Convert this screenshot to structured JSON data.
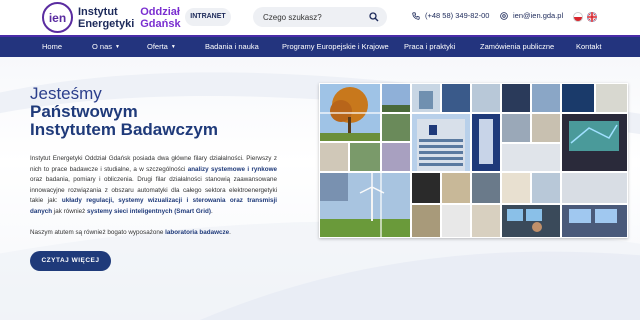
{
  "header": {
    "logo_mark": "ien",
    "logo_line1": "Instytut",
    "logo_line2": "Energetyki",
    "logo_sub1": "Oddział",
    "logo_sub2": "Gdańsk",
    "intranet_label": "INTRANET",
    "search_placeholder": "Czego szukasz?",
    "phone": "(+48 58) 349-82-00",
    "email": "ien@ien.gda.pl",
    "languages": [
      "pl",
      "en"
    ]
  },
  "nav": {
    "items": [
      {
        "label": "Home"
      },
      {
        "label": "O nas",
        "dropdown": true
      },
      {
        "label": "Oferta",
        "dropdown": true
      },
      {
        "label": "Badania i nauka"
      },
      {
        "label": "Programy Europejskie i Krajowe"
      },
      {
        "label": "Praca i praktyki"
      },
      {
        "label": "Zamówienia publiczne"
      },
      {
        "label": "Kontakt"
      }
    ]
  },
  "hero": {
    "heading_line1": "Jesteśmy",
    "heading_line2": "Państwowym",
    "heading_line3": "Instytutem Badawczym",
    "para1_a": "Instytut Energetyki Oddział Gdańsk posiada dwa główne filary działalności. Pierwszy z nich to prace badawcze i studialne, a w szczególności ",
    "para1_b": "analizy systemowe i rynkowe",
    "para1_c": " oraz badania, pomiary i obliczenia. Drugi filar działalności stanowią zaawansowane innowacyjne rozwiązania z obszaru automatyki dla całego sektora elektroenergetyki takie jak: ",
    "para1_d": "układy regulacji, systemy wizualizacji i sterowania oraz transmisji danych",
    "para1_e": " jak również ",
    "para1_f": "systemy sieci inteligentnych (Smart Grid)",
    "para1_g": ".",
    "para2_a": "Naszym atutem są również bogato wyposażone ",
    "para2_b": "laboratoria badawcze",
    "para2_c": ".",
    "button_label": "CZYTAJ WIĘCEJ"
  },
  "colors": {
    "primary": "#1f3a7a",
    "nav_bg": "#23347e",
    "accent_purple": "#5a2ca0",
    "logo_sub": "#7a2ed0"
  }
}
